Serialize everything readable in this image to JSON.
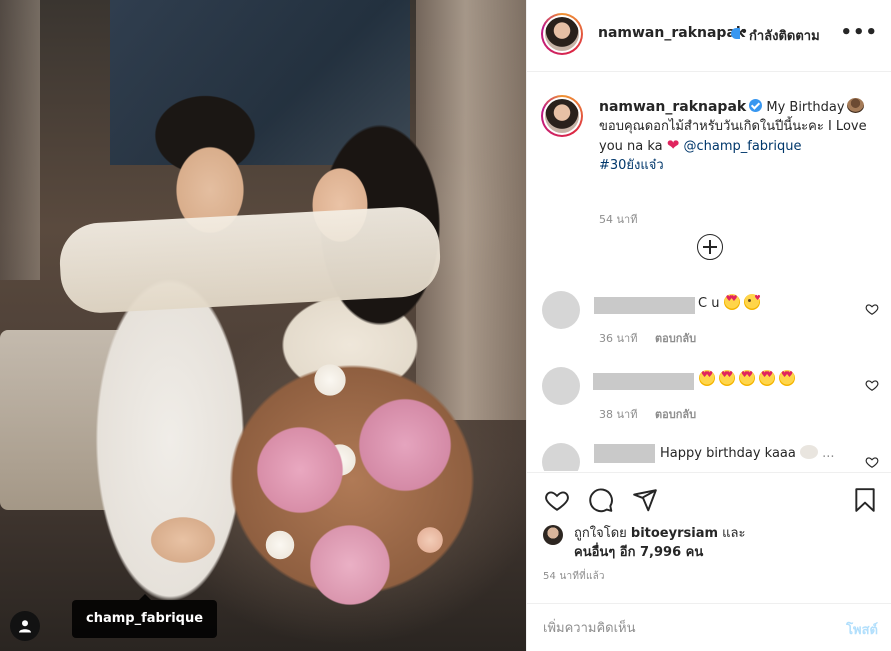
{
  "post": {
    "username": "namwan_raknapak",
    "follow_state": "กำลังติดตาม",
    "dot": "•",
    "more": "•••",
    "tag_label": "champ_fabrique"
  },
  "caption": {
    "username": "namwan_raknapak",
    "text_1": "My Birthday",
    "text_2": "ขอบคุณดอกไม้สำหรับวันเกิดในปีนี้นะคะ I Love you na ka",
    "mention": "@champ_fabrique",
    "hashtag": "#30ยังแจ๋ว",
    "time": "54 นาที"
  },
  "comments": [
    {
      "text": "C u",
      "time": "36 นาที",
      "reply": "ตอบกลับ"
    },
    {
      "text": "",
      "time": "38 นาที",
      "reply": "ตอบกลับ"
    },
    {
      "text": "Happy birthday kaaa",
      "time": "",
      "reply": ""
    }
  ],
  "likes": {
    "prefix": "ถูกใจโดย",
    "user": "bitoeyrsiam",
    "and": "และ",
    "others": "คนอื่นๆ อีก 7,996 คน"
  },
  "post_time": "54 นาทีที่แล้ว",
  "comment_box": {
    "placeholder": "เพิ่มความคิดเห็น",
    "post_label": "โพสต์"
  },
  "icons": [
    "user-tag-icon",
    "heart-icon",
    "comment-icon",
    "share-icon",
    "bookmark-icon",
    "add-circle-icon",
    "verified-badge-icon",
    "more-options-icon"
  ],
  "colors": {
    "link": "#00376b",
    "verified": "#3897f0",
    "post_button_disabled": "#b2dffc",
    "muted": "#8e8e8e"
  }
}
